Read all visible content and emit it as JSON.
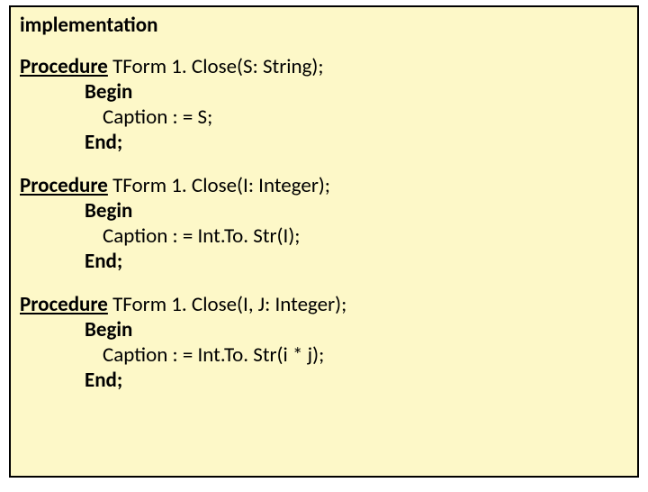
{
  "section_title": "implementation",
  "procedures": [
    {
      "keyword": "Procedure",
      "signature": " TForm 1. Close(S: String);",
      "begin": "Begin",
      "body": "Caption : = S;",
      "end": "End;"
    },
    {
      "keyword": "Procedure",
      "signature": " TForm 1. Close(I: Integer);",
      "begin": "Begin",
      "body": "Caption : = Int.To. Str(I);",
      "end": "End;"
    },
    {
      "keyword": "Procedure",
      "signature": " TForm 1. Close(I, J: Integer);",
      "begin": "Begin",
      "body": "Caption : = Int.To. Str(i * j);",
      "end": "End;"
    }
  ]
}
